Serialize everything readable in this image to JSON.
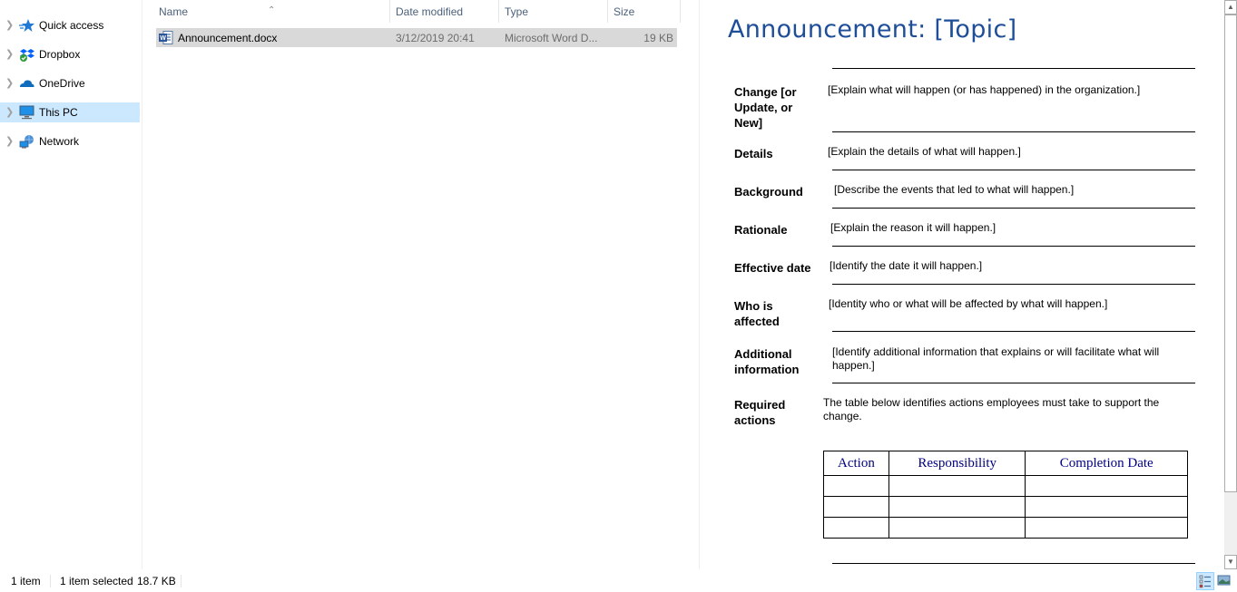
{
  "nav": {
    "items": [
      {
        "label": "Quick access",
        "icon": "star-icon",
        "selected": false
      },
      {
        "label": "Dropbox",
        "icon": "dropbox-icon",
        "selected": false
      },
      {
        "label": "OneDrive",
        "icon": "cloud-icon",
        "selected": false
      },
      {
        "label": "This PC",
        "icon": "computer-icon",
        "selected": true
      },
      {
        "label": "Network",
        "icon": "network-icon",
        "selected": false
      }
    ]
  },
  "filelist": {
    "columns": [
      "Name",
      "Date modified",
      "Type",
      "Size"
    ],
    "sort_column": "Name",
    "rows": [
      {
        "name": "Announcement.docx",
        "date": "3/12/2019 20:41",
        "type": "Microsoft Word D...",
        "size": "19 KB",
        "icon": "word-doc-icon",
        "selected": true
      }
    ]
  },
  "preview": {
    "title": "Announcement: [Topic]",
    "fields": [
      {
        "label": "Change [or Update, or New]",
        "value": "[Explain what will happen (or has happened) in the organization.]"
      },
      {
        "label": "Details",
        "value": "[Explain the details of what will happen.]"
      },
      {
        "label": "Background",
        "value": "[Describe the events that led to what will happen.]"
      },
      {
        "label": "Rationale",
        "value": "[Explain the reason it will happen.]"
      },
      {
        "label": "Effective date",
        "value": "[Identify the date it will happen.]"
      },
      {
        "label": "Who is affected",
        "value": "[Identity who or what will be affected by what will happen.]"
      },
      {
        "label": "Additional information",
        "value": "[Identify additional information that explains or will facilitate what will happen.]"
      },
      {
        "label": "Required actions",
        "value": "The table below identifies actions employees must take to support the change."
      }
    ],
    "table": {
      "headers": [
        "Action",
        "Responsibility",
        "Completion Date"
      ],
      "rows": [
        [
          "",
          "",
          ""
        ],
        [
          "",
          "",
          ""
        ],
        [
          "",
          "",
          ""
        ]
      ]
    }
  },
  "status": {
    "item_count": "1 item",
    "selection": "1 item selected",
    "selection_size": "18.7 KB"
  },
  "colors": {
    "accent_selected": "#cce8ff",
    "doc_title": "#1f4e99",
    "table_header": "#000080"
  }
}
